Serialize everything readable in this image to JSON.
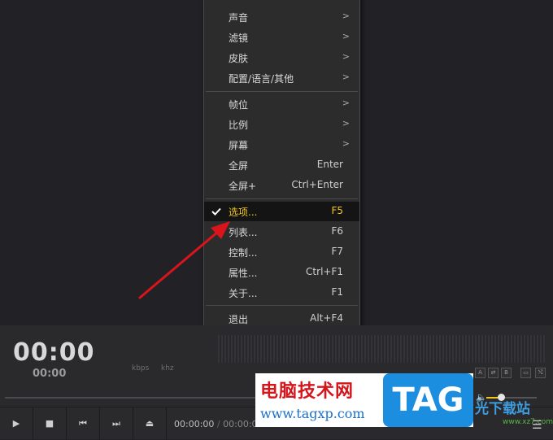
{
  "menu": {
    "items_group1": [
      {
        "label": "声音",
        "has_submenu": true
      },
      {
        "label": "滤镜",
        "has_submenu": true
      },
      {
        "label": "皮肤",
        "has_submenu": true
      },
      {
        "label": "配置/语言/其他",
        "has_submenu": true
      }
    ],
    "items_group2": [
      {
        "label": "帧位",
        "has_submenu": true
      },
      {
        "label": "比例",
        "has_submenu": true
      },
      {
        "label": "屏幕",
        "has_submenu": true
      },
      {
        "label": "全屏",
        "shortcut": "Enter"
      },
      {
        "label": "全屏+",
        "shortcut": "Ctrl+Enter"
      }
    ],
    "items_group3": [
      {
        "label": "选项...",
        "shortcut": "F5",
        "checked": true,
        "highlighted": true
      },
      {
        "label": "列表...",
        "shortcut": "F6"
      },
      {
        "label": "控制...",
        "shortcut": "F7"
      },
      {
        "label": "属性...",
        "shortcut": "Ctrl+F1"
      },
      {
        "label": "关于...",
        "shortcut": "F1"
      }
    ],
    "items_group4": [
      {
        "label": "退出",
        "shortcut": "Alt+F4"
      }
    ],
    "arrow_glyph": ">",
    "highlight_color": "#f3c522"
  },
  "player": {
    "time_big": "00:00",
    "time_small": "00:00",
    "kbps_label": "kbps",
    "khz_label": "khz",
    "time_current": "00:00:00",
    "time_separator": "/",
    "time_total": "00:00:00",
    "small_buttons": [
      "A",
      "⇄",
      "B"
    ],
    "right_buttons": [
      "▭",
      "⤭"
    ],
    "controls": [
      {
        "name": "play-icon",
        "glyph": "▶"
      },
      {
        "name": "stop-icon",
        "glyph": "■"
      },
      {
        "name": "prev-icon",
        "glyph": "⏮"
      },
      {
        "name": "next-icon",
        "glyph": "⏭"
      },
      {
        "name": "eject-icon",
        "glyph": "⏏"
      }
    ],
    "volume_level": 0.25,
    "volume_glyph": "🔈",
    "menu_glyph": "☰"
  },
  "watermark": {
    "title": "电脑技术网",
    "url": "www.tagxp.com",
    "tag": "TAG",
    "xz_text": "光下载站",
    "xz_url": "www.xz7.com"
  },
  "colors": {
    "arrow": "#d9151b",
    "accent": "#f3c522"
  }
}
